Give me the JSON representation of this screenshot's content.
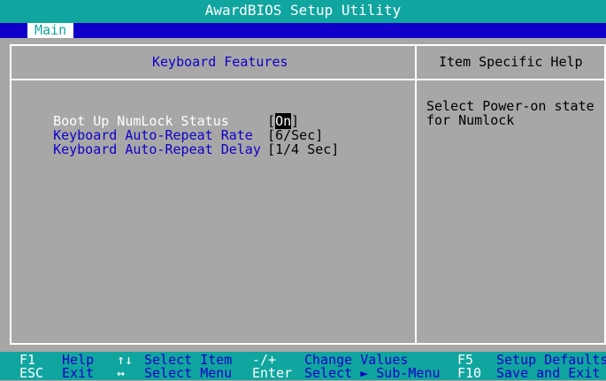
{
  "window": {
    "title": "AwardBIOS Setup Utility"
  },
  "menu": {
    "active_tab": "Main"
  },
  "panel": {
    "title": "Keyboard Features",
    "help_title": "Item Specific Help",
    "help_text": "Select Power-on state for Numlock"
  },
  "settings": [
    {
      "label": "Boot Up NumLock Status",
      "value_prefix": "[",
      "value": "On",
      "value_suffix": "]",
      "selected": true
    },
    {
      "label": "Keyboard Auto-Repeat Rate",
      "value": "[6/Sec]"
    },
    {
      "label": "Keyboard Auto-Repeat Delay",
      "value": "[1/4 Sec]"
    }
  ],
  "status_keys": [
    {
      "key": "F1",
      "desc": "Help"
    },
    {
      "key": "ESC",
      "desc": "Exit"
    },
    {
      "key": "↑↓",
      "desc": "Select Item"
    },
    {
      "key": "↔",
      "desc": "Select Menu"
    },
    {
      "key": "-/+",
      "desc": "Change Values"
    },
    {
      "key": "Enter",
      "desc": "Select ► Sub-Menu"
    },
    {
      "key": "F5",
      "desc": "Setup Defaults"
    },
    {
      "key": "F10",
      "desc": "Save and Exit"
    }
  ],
  "colors": {
    "background": "#a7a7a7",
    "title_bar": "#11a59f",
    "menu_bar": "#0f00c8",
    "text_blue": "#0f00c8",
    "highlight": "#ffffff"
  }
}
